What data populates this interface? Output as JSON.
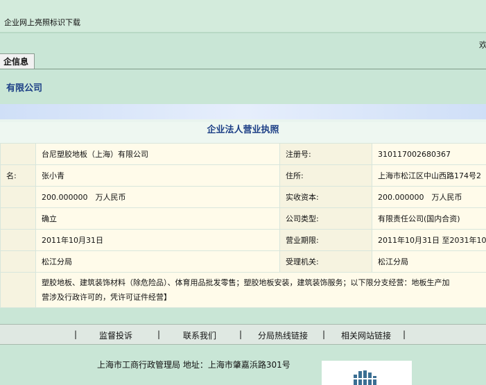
{
  "header": {
    "title": "企业网上亮照标识下载",
    "welcome": "欢"
  },
  "tab": {
    "label": "企信息"
  },
  "company_name": "有限公司",
  "license_title": "企业法人营业执照",
  "rows": [
    {
      "left_label": "",
      "left_value": "台尼塑胶地板（上海）有限公司",
      "right_label": "注册号:",
      "right_value": "310117002680367"
    },
    {
      "left_label": "名:",
      "left_value": "张小青",
      "right_label": "住所:",
      "right_value": "上海市松江区中山西路174号2"
    },
    {
      "left_label": "",
      "left_value": "200.000000　万人民币",
      "right_label": "实收资本:",
      "right_value": "200.000000　万人民币"
    },
    {
      "left_label": "",
      "left_value": "确立",
      "right_label": "公司类型:",
      "right_value": "有限责任公司(国内合资)"
    },
    {
      "left_label": "",
      "left_value": "2011年10月31日",
      "right_label": "营业期限:",
      "right_value": "2011年10月31日 至2031年10月"
    },
    {
      "left_label": "",
      "left_value": "松江分局",
      "right_label": "受理机关:",
      "right_value": "松江分局"
    }
  ],
  "scope_line1": "塑胶地板、建筑装饰材料（除危险品）、体育用品批发零售；塑胶地板安装，建筑装饰服务；以下限分支经营：地板生产加",
  "scope_line2": "营涉及行政许可的，凭许可证件经营】",
  "footer_nav": {
    "separator": "|",
    "links": [
      "监督投诉",
      "联系我们",
      "分局热线链接",
      "相关网站链接"
    ]
  },
  "footer_address": "上海市工商行政管理局 地址：上海市肇嘉浜路301号",
  "colors": {
    "background": "#c9e6d6",
    "title_blue": "#1c3f86",
    "table_bg": "#fffbea"
  }
}
